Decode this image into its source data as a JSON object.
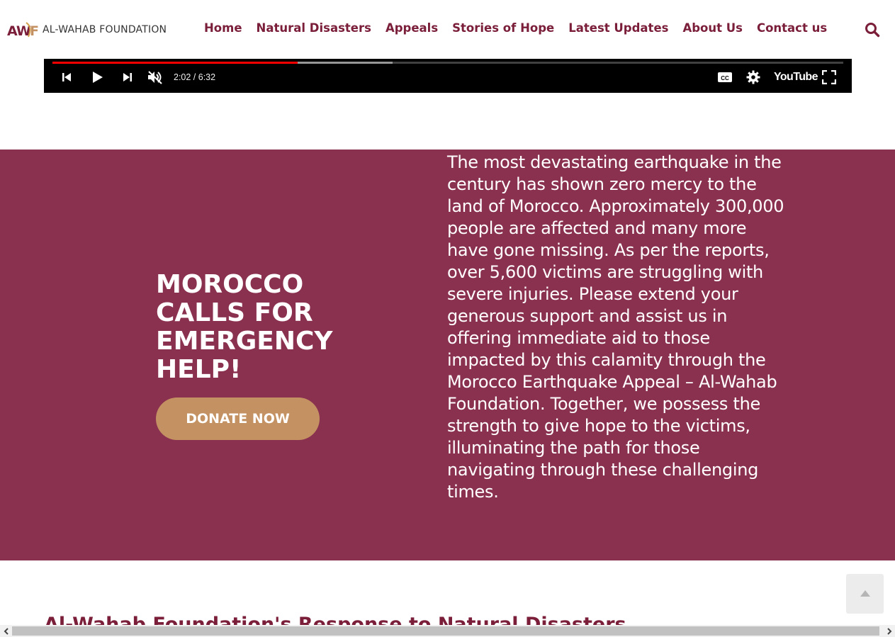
{
  "brand": {
    "logo_mark": "AWF",
    "name": "AL-WAHAB FOUNDATION",
    "colors": {
      "primary": "#7a1e3a",
      "band": "#8b3150",
      "accent": "#c49262"
    }
  },
  "nav": {
    "items": [
      {
        "label": "Home"
      },
      {
        "label": "Natural Disasters"
      },
      {
        "label": "Appeals"
      },
      {
        "label": "Stories of Hope"
      },
      {
        "label": "Latest Updates"
      },
      {
        "label": "About Us"
      },
      {
        "label": "Contact us"
      }
    ],
    "search_icon": "search-icon"
  },
  "video_player": {
    "time": "2:02 / 6:32",
    "played_fraction": 0.31,
    "buffered_fraction": 0.43,
    "brand": "YouTube",
    "icons": [
      "previous-icon",
      "play-icon",
      "next-icon",
      "muted-icon",
      "captions-icon",
      "settings-icon",
      "youtube-icon",
      "fullscreen-icon"
    ]
  },
  "appeal": {
    "title": "MOROCCO CALLS FOR EMERGENCY HELP!",
    "donate_label": "DONATE NOW",
    "body": "The most devastating earthquake in the century has shown zero mercy to the land of Morocco. Approximately 300,000 people are affected and many more have gone missing. As per the reports, over 5,600 victims are struggling with severe injuries. Please extend your generous support and assist us in offering immediate aid to those impacted by this calamity through the Morocco Earthquake Appeal – Al-Wahab Foundation. Together, we possess the strength to give hope to the victims, illuminating the path for those navigating through these challenging times."
  },
  "section": {
    "heading": "Al-Wahab Foundation's Response to Natural Disasters"
  },
  "back_to_top_icon": "chevron-up-icon"
}
